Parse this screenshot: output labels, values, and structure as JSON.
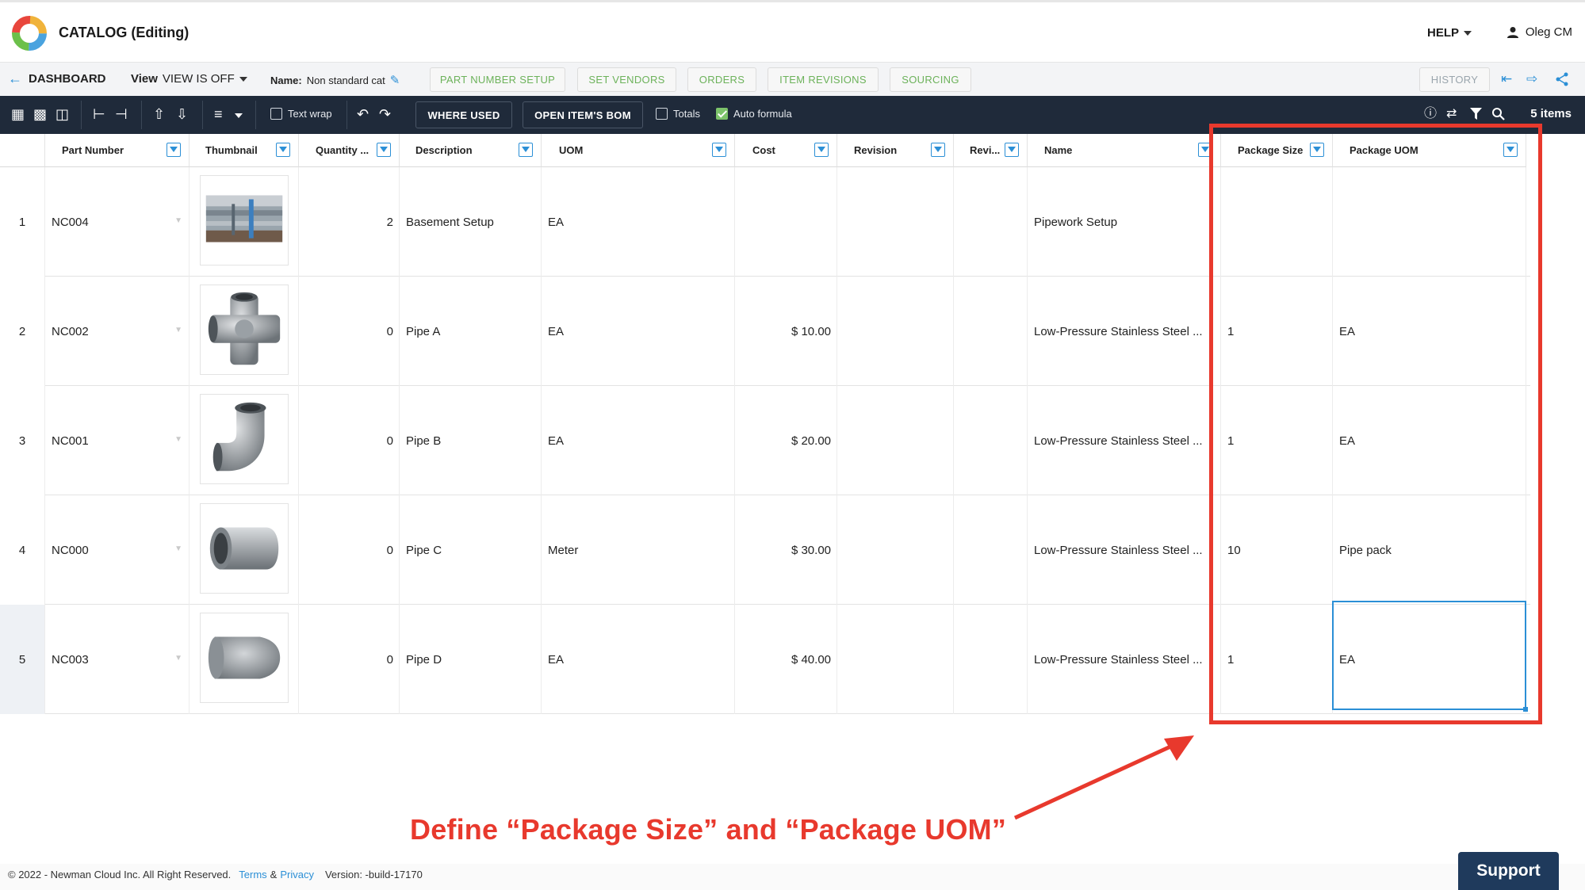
{
  "app": {
    "title": "CATALOG (Editing)",
    "help_label": "HELP",
    "user_name": "Oleg CM"
  },
  "nav": {
    "back_label": "DASHBOARD",
    "view_prefix": "View",
    "view_value": "VIEW IS OFF",
    "name_prefix": "Name:",
    "name_value": "Non standard cat",
    "tabs": [
      "PART NUMBER SETUP",
      "SET VENDORS",
      "ORDERS",
      "ITEM REVISIONS",
      "SOURCING"
    ],
    "history_label": "HISTORY"
  },
  "toolbar": {
    "text_wrap_label": "Text wrap",
    "where_used_label": "WHERE USED",
    "open_bom_label": "OPEN ITEM'S BOM",
    "totals_label": "Totals",
    "auto_formula_label": "Auto formula",
    "items_count": "5 items"
  },
  "grid": {
    "columns": [
      "Part Number",
      "Thumbnail",
      "Quantity ...",
      "Description",
      "UOM",
      "Cost",
      "Revision",
      "Revi...",
      "Name",
      "Package Size",
      "Package UOM"
    ],
    "rows": [
      {
        "index": "1",
        "part_number": "NC004",
        "quantity": "2",
        "description": "Basement Setup",
        "uom": "EA",
        "cost": "",
        "revision": "",
        "revi": "",
        "name": "Pipework Setup",
        "package_size": "",
        "package_uom": ""
      },
      {
        "index": "2",
        "part_number": "NC002",
        "quantity": "0",
        "description": "Pipe A",
        "uom": "EA",
        "cost": "$ 10.00",
        "revision": "",
        "revi": "",
        "name": "Low-Pressure Stainless Steel ...",
        "package_size": "1",
        "package_uom": "EA"
      },
      {
        "index": "3",
        "part_number": "NC001",
        "quantity": "0",
        "description": "Pipe B",
        "uom": "EA",
        "cost": "$ 20.00",
        "revision": "",
        "revi": "",
        "name": "Low-Pressure Stainless Steel ...",
        "package_size": "1",
        "package_uom": "EA"
      },
      {
        "index": "4",
        "part_number": "NC000",
        "quantity": "0",
        "description": "Pipe C",
        "uom": "Meter",
        "cost": "$ 30.00",
        "revision": "",
        "revi": "",
        "name": "Low-Pressure Stainless Steel ...",
        "package_size": "10",
        "package_uom": "Pipe pack"
      },
      {
        "index": "5",
        "part_number": "NC003",
        "quantity": "0",
        "description": "Pipe D",
        "uom": "EA",
        "cost": "$ 40.00",
        "revision": "",
        "revi": "",
        "name": "Low-Pressure Stainless Steel ...",
        "package_size": "1",
        "package_uom": "EA"
      }
    ]
  },
  "annotation": {
    "text": "Define “Package Size” and “Package UOM”",
    "color": "#e8392d"
  },
  "footer": {
    "copyright": "© 2022 - Newman Cloud Inc. All Right Reserved.",
    "terms": "Terms",
    "amp": "&",
    "privacy": "Privacy",
    "version": "Version: -build-17170",
    "support_label": "Support"
  },
  "colors": {
    "accent": "#2b8fd6",
    "toolbar_bg": "#1f2a3a",
    "tab_green": "#6cb25a",
    "support_bg": "#1f3a5c"
  }
}
